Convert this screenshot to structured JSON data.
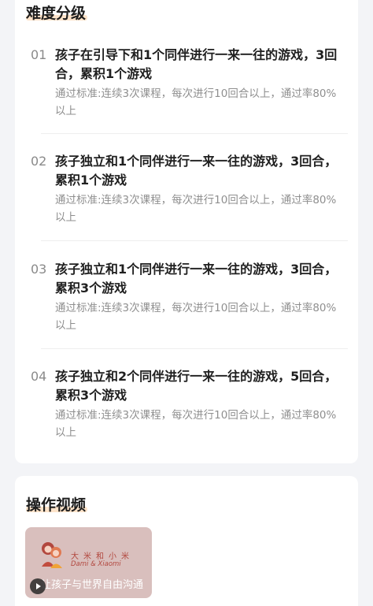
{
  "difficulty_section": {
    "title": "难度分级",
    "levels": [
      {
        "number": "01",
        "title": "孩子在引导下和1个同伴进行一来一往的游戏，3回合，累积1个游戏",
        "criteria": "通过标准:连续3次课程，每次进行10回合以上，通过率80%以上"
      },
      {
        "number": "02",
        "title": "孩子独立和1个同伴进行一来一往的游戏，3回合，累积1个游戏",
        "criteria": "通过标准:连续3次课程，每次进行10回合以上，通过率80%以上"
      },
      {
        "number": "03",
        "title": "孩子独立和1个同伴进行一来一往的游戏，3回合，累积3个游戏",
        "criteria": "通过标准:连续3次课程，每次进行10回合以上，通过率80%以上"
      },
      {
        "number": "04",
        "title": "孩子独立和2个同伴进行一来一往的游戏，5回合，累积3个游戏",
        "criteria": "通过标准:连续3次课程，每次进行10回合以上，通过率80%以上"
      }
    ]
  },
  "video_section": {
    "title": "操作视频",
    "thumbnail": {
      "brand_cn": "大米和小米",
      "brand_en": "Dami & Xiaomi",
      "slogan": "让孩子与世界自由沟通",
      "play_icon": "play-icon",
      "logo_icon": "brand-logo-icon"
    }
  },
  "colors": {
    "accent_underline": "#fde3c9",
    "brand": "#b2473e",
    "background": "#f3f4f7"
  }
}
